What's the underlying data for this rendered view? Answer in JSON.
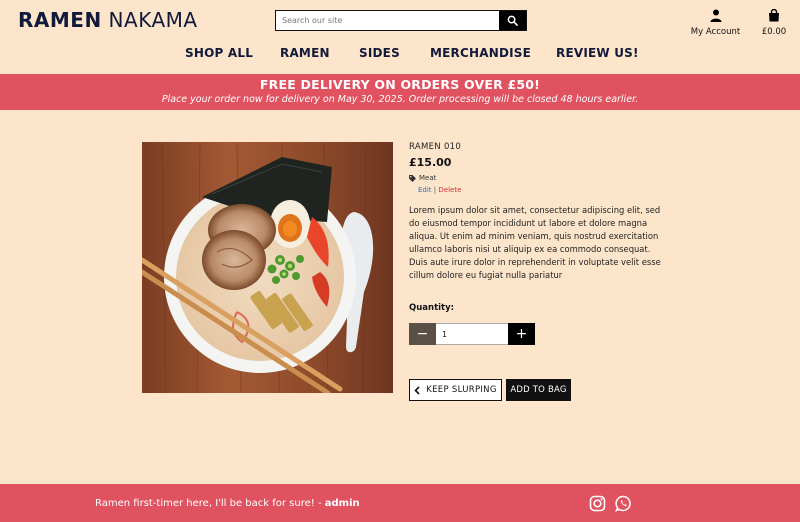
{
  "brand": {
    "bold": "RAMEN",
    "light": "NAKAMA"
  },
  "search": {
    "placeholder": "Search our site"
  },
  "account": {
    "label": "My Account"
  },
  "bag": {
    "total": "£0.00"
  },
  "nav": {
    "items": [
      "SHOP ALL",
      "RAMEN",
      "SIDES",
      "MERCHANDISE",
      "REVIEW US!"
    ]
  },
  "banner": {
    "title": "FREE DELIVERY ON ORDERS OVER £50!",
    "subtitle": "Place your order now for delivery on May 30, 2025. Order processing will be closed 48 hours earlier."
  },
  "product": {
    "name": "RAMEN 010",
    "price": "£15.00",
    "category": "Meat",
    "edit_label": "Edit",
    "separator": "|",
    "delete_label": "Delete",
    "description": "Lorem ipsum dolor sit amet, consectetur adipiscing elit, sed do eiusmod tempor incididunt ut labore et dolore magna aliqua. Ut enim ad minim veniam, quis nostrud exercitation ullamco laboris nisi ut aliquip ex ea commodo consequat. Duis aute irure dolor in reprehenderit in voluptate velit esse cillum dolore eu fugiat nulla pariatur"
  },
  "quantity": {
    "label": "Quantity:",
    "value": "1",
    "minus": "−",
    "plus": "+"
  },
  "buttons": {
    "keep": "KEEP SLURPING",
    "add": "ADD TO BAG"
  },
  "footer": {
    "review_text": "Ramen first-timer here, I'll be back for sure! - ",
    "review_author": "admin"
  },
  "colors": {
    "background": "#fde5cb",
    "accent": "#e0525f",
    "navy": "#111a3a",
    "link_blue": "#2f6fbe",
    "link_red": "#d0343c"
  }
}
